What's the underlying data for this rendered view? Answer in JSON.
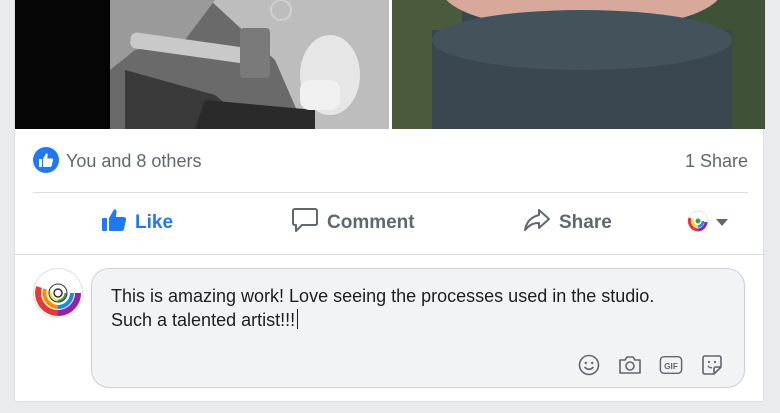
{
  "reactions": {
    "summary": "You and 8 others",
    "shares": "1 Share"
  },
  "actions": {
    "like_label": "Like",
    "comment_label": "Comment",
    "share_label": "Share"
  },
  "comment_box": {
    "text_line1": "This is amazing work! Love seeing the processes used in the studio.",
    "text_line2": "Such a talented artist!!!",
    "icons": [
      "emoji-icon",
      "camera-icon",
      "gif-icon",
      "sticker-icon"
    ]
  },
  "colors": {
    "accent": "#2078f4",
    "text_secondary": "#606770",
    "composer_bg": "#f2f3f5"
  }
}
